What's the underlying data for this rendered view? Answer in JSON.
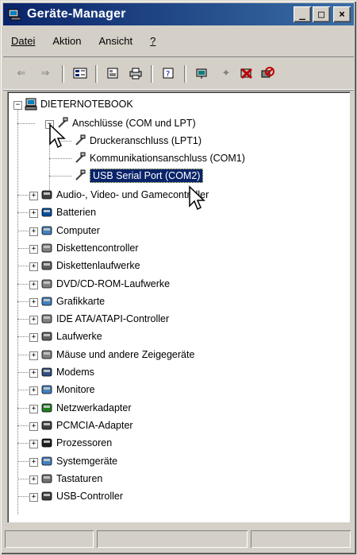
{
  "window": {
    "title": "Geräte-Manager"
  },
  "title_buttons": {
    "minimize": "_",
    "maximize": "□",
    "close": "×"
  },
  "menu": [
    {
      "label": "Datei"
    },
    {
      "label": "Aktion"
    },
    {
      "label": "Ansicht"
    },
    {
      "label": "?"
    }
  ],
  "toolbar": {
    "icons": [
      "back-icon",
      "forward-icon",
      "view-icon",
      "properties-icon",
      "print-icon",
      "help-icon",
      "scan-icon",
      "uninstall-icon",
      "disable-icon",
      "update-driver-icon"
    ]
  },
  "tree": {
    "root": "DIETERNOTEBOOK",
    "expanded_group": "Anschlüsse (COM und LPT)",
    "children": [
      "Druckeranschluss (LPT1)",
      "Kommunikationsanschluss (COM1)",
      "USB Serial Port (COM2)"
    ],
    "selected": "USB Serial Port (COM2)",
    "groups": [
      "Audio-, Video- und Gamecontroller",
      "Batterien",
      "Computer",
      "Diskettencontroller",
      "Diskettenlaufwerke",
      "DVD/CD-ROM-Laufwerke",
      "Grafikkarte",
      "IDE ATA/ATAPI-Controller",
      "Laufwerke",
      "Mäuse und andere Zeigegeräte",
      "Modems",
      "Monitore",
      "Netzwerkadapter",
      "PCMCIA-Adapter",
      "Prozessoren",
      "Systemgeräte",
      "Tastaturen",
      "USB-Controller"
    ]
  },
  "colors": {
    "titlebar": "#0a246a",
    "selection": "#0a246a",
    "face": "#d4d0c8"
  }
}
